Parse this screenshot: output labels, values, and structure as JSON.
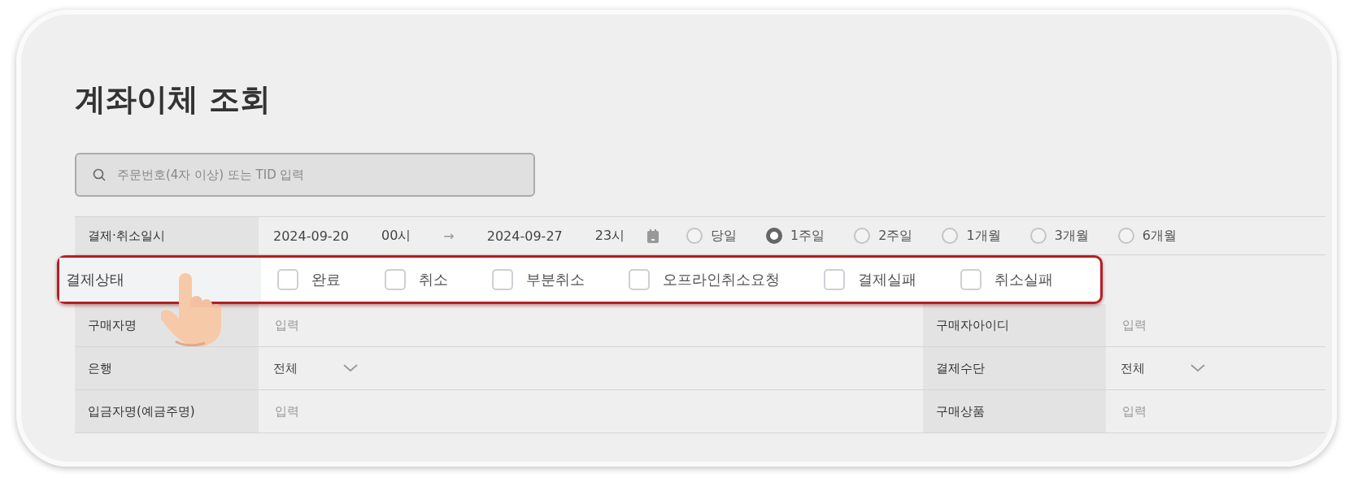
{
  "page": {
    "title": "계좌이체 조회"
  },
  "search": {
    "placeholder": "주문번호(4자 이상) 또는 TID 입력"
  },
  "date_filter": {
    "label": "결제·취소일시",
    "from_date": "2024-09-20",
    "from_hour": "00시",
    "arrow": "→",
    "to_date": "2024-09-27",
    "to_hour": "23시",
    "periods": [
      {
        "label": "당일",
        "selected": false
      },
      {
        "label": "1주일",
        "selected": true
      },
      {
        "label": "2주일",
        "selected": false
      },
      {
        "label": "1개월",
        "selected": false
      },
      {
        "label": "3개월",
        "selected": false
      },
      {
        "label": "6개월",
        "selected": false
      }
    ]
  },
  "status_filter": {
    "label": "결제상태",
    "highlighted": true,
    "options": [
      {
        "label": "완료",
        "checked": false
      },
      {
        "label": "취소",
        "checked": false
      },
      {
        "label": "부분취소",
        "checked": false
      },
      {
        "label": "오프라인취소요청",
        "checked": false
      },
      {
        "label": "결제실패",
        "checked": false
      },
      {
        "label": "취소실패",
        "checked": false
      }
    ]
  },
  "rows": [
    {
      "left": {
        "label": "구매자명",
        "kind": "input",
        "placeholder": "입력"
      },
      "right": {
        "label": "구매자아이디",
        "kind": "input",
        "placeholder": "입력"
      }
    },
    {
      "left": {
        "label": "은행",
        "kind": "select",
        "value": "전체"
      },
      "right": {
        "label": "결제수단",
        "kind": "select",
        "value": "전체"
      }
    },
    {
      "left": {
        "label": "입금자명(예금주명)",
        "kind": "input",
        "placeholder": "입력"
      },
      "right": {
        "label": "구매상품",
        "kind": "input",
        "placeholder": "입력"
      }
    }
  ]
}
